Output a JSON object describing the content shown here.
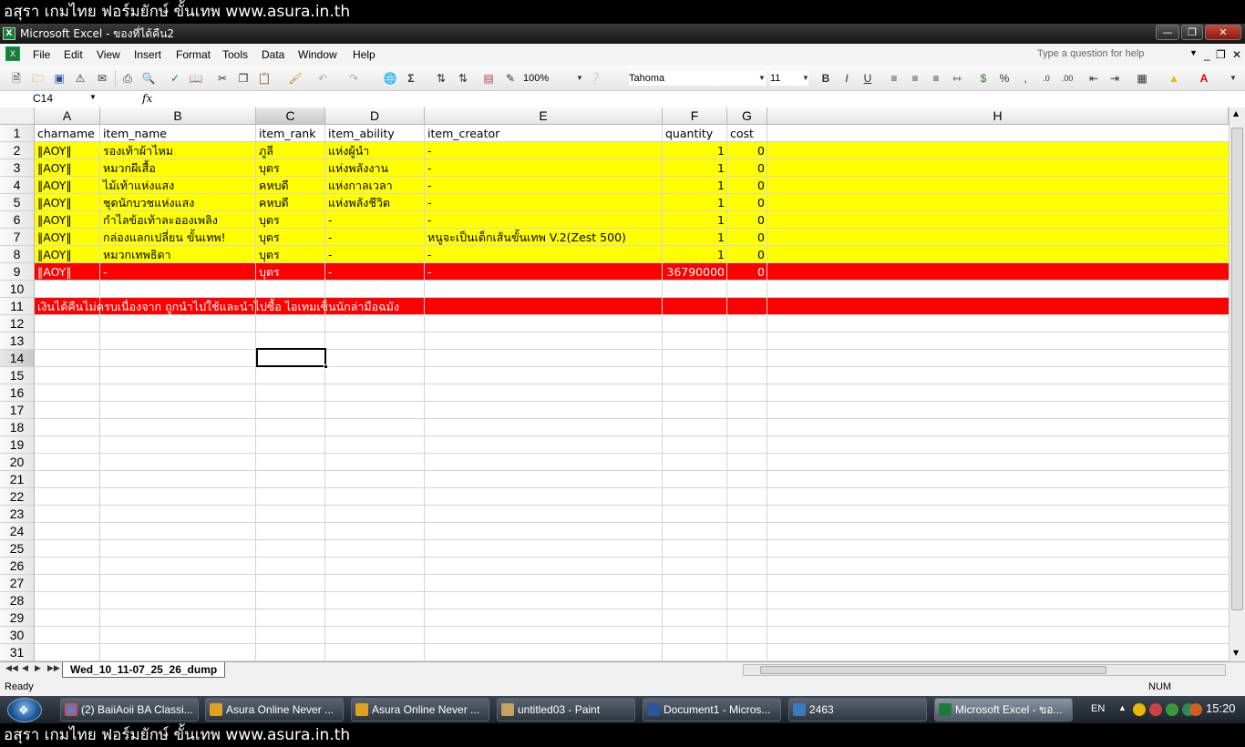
{
  "banner": {
    "text": "อสุรา เกมไทย ฟอร์มยักษ์ ขั้นเทพ www.asura.in.th"
  },
  "window": {
    "title": "Microsoft Excel - ของที่ได้คืน2"
  },
  "menu": [
    "File",
    "Edit",
    "View",
    "Insert",
    "Format",
    "Tools",
    "Data",
    "Window",
    "Help"
  ],
  "help_placeholder": "Type a question for help",
  "toolbar": {
    "zoom": "100%",
    "font": "Tahoma",
    "size": "11"
  },
  "formula": {
    "name_box": "C14",
    "fx": "fx"
  },
  "columns": [
    "A",
    "B",
    "C",
    "D",
    "E",
    "F",
    "G",
    "H"
  ],
  "rows": [
    "1",
    "2",
    "3",
    "4",
    "5",
    "6",
    "7",
    "8",
    "9",
    "10",
    "11",
    "12",
    "13",
    "14",
    "15",
    "16",
    "17",
    "18",
    "19",
    "20",
    "21",
    "22",
    "23",
    "24",
    "25",
    "26",
    "27",
    "28",
    "29",
    "30",
    "31"
  ],
  "header_row": [
    "charname",
    "item_name",
    "item_rank",
    "item_ability",
    "item_creator",
    "quantity",
    "cost"
  ],
  "data_rows": [
    [
      "‖AOY‖",
      "รองเท้าผ้าไหม",
      "ภูลี",
      "แห่งผู้นำ",
      "-",
      "1",
      "0"
    ],
    [
      "‖AOY‖",
      "หมวกผีเสื้อ",
      "บุตร",
      "แห่งพลังงาน",
      "-",
      "1",
      "0"
    ],
    [
      "‖AOY‖",
      "ไม้เท้าแห่งแสง",
      "คหบดี",
      "แห่งกาลเวลา",
      "-",
      "1",
      "0"
    ],
    [
      "‖AOY‖",
      "ชุดนักบวชแห่งแสง",
      "คหบดี",
      "แห่งพลังชีวิต",
      "-",
      "1",
      "0"
    ],
    [
      "‖AOY‖",
      "กำไลข้อเท้าละอองเพลิง",
      "บุตร",
      "-",
      "-",
      "1",
      "0"
    ],
    [
      "‖AOY‖",
      "กล่องแลกเปลี่ยน ขั้นเทพ!",
      "บุตร",
      "-",
      "หนูจะเป็นเด็กเส้นขั้นเทพ V.2(Zest 500)",
      "1",
      "0"
    ],
    [
      "‖AOY‖",
      "หมวกเทพธิดา",
      "บุตร",
      "-",
      "-",
      "1",
      "0"
    ],
    [
      "‖AOY‖",
      "-",
      "บุตร",
      "-",
      "-",
      "36790000",
      "0"
    ]
  ],
  "note_row": "เงินได้คืนไม่ครบเนื่องจาก ถูกนำไปใช้และนำไปซื้อ ไอเทมเซ็นนักล่ามือฉมัง",
  "sheet_tab": "Wed_10_11-07_25_26_dump",
  "status": {
    "ready": "Ready",
    "num": "NUM"
  },
  "taskbar": {
    "tasks": [
      "(2) BaiiAoii BA Classi...",
      "Asura Online Never ...",
      "Asura Online Never ...",
      "untitled03 - Paint",
      "Document1 - Micros...",
      "2463",
      "Microsoft Excel - ขอ..."
    ],
    "lang": "EN",
    "clock": "15:20"
  },
  "colors": {
    "yellow": "#ffff00",
    "red": "#ff0000"
  }
}
